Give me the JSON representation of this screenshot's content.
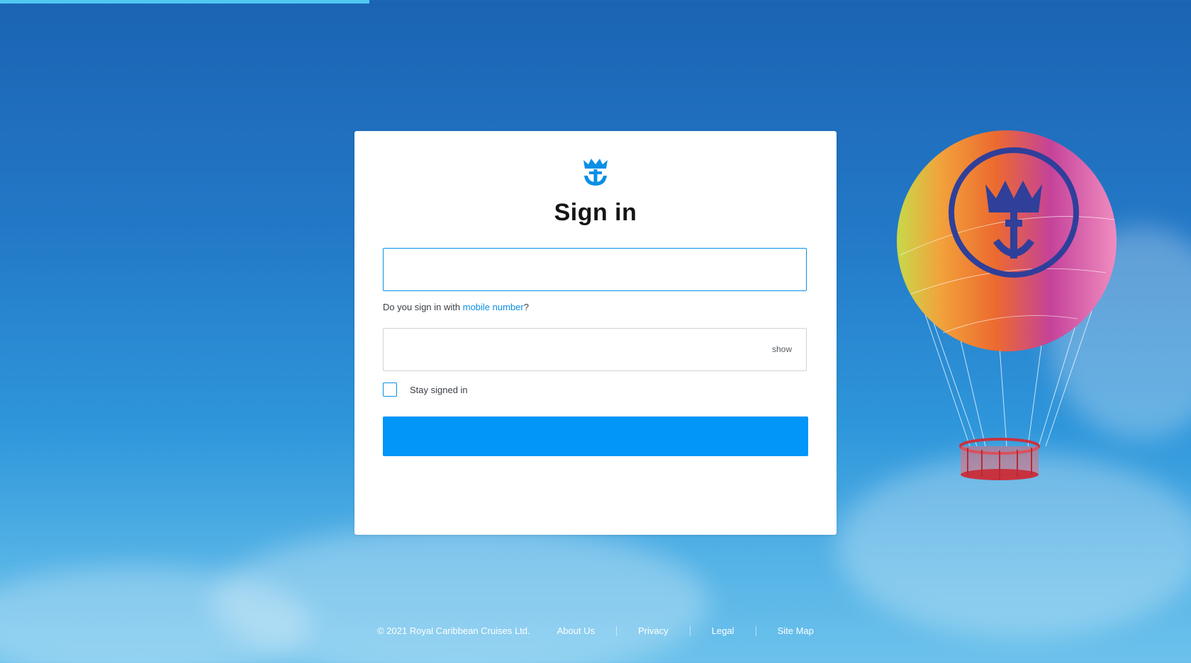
{
  "progress": {
    "value_fraction": 0.31
  },
  "logo": {
    "icon": "crown-anchor-icon"
  },
  "signin": {
    "title": "Sign in",
    "email": {
      "value": "",
      "placeholder": ""
    },
    "mobile_prompt": "Do you sign in with ",
    "mobile_link": "mobile number",
    "mobile_suffix": "?",
    "password": {
      "value": "",
      "placeholder": ""
    },
    "show_label": "show",
    "stay_signed_in": {
      "label": "Stay signed in",
      "checked": false
    },
    "submit_label": ""
  },
  "footer": {
    "copyright": "© 2021 Royal Caribbean Cruises Ltd.",
    "links": [
      "About Us",
      "Privacy",
      "Legal",
      "Site Map"
    ]
  },
  "colors": {
    "accent": "#0296f8",
    "link": "#0a8fe6",
    "sky_top": "#1b63b3",
    "sky_bottom": "#6cc2ec"
  }
}
